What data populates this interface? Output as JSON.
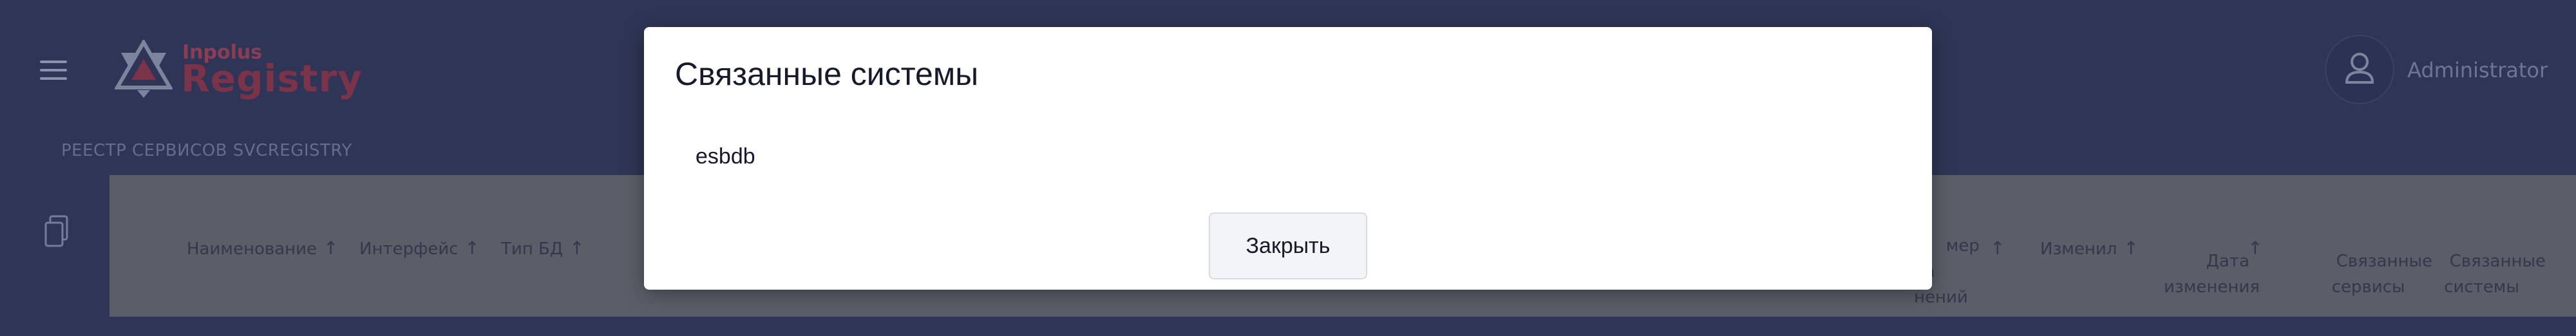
{
  "header": {
    "logo_small": "Inpolus",
    "logo_big": "Registry",
    "user_name": "Administrator",
    "menu_icon": "menu-icon",
    "user_icon": "user-icon"
  },
  "breadcrumb": "РЕЕСТР СЕРВИСОВ SVCREGISTRY",
  "sidebar": {
    "icon": "document-copy-icon"
  },
  "table": {
    "headers": [
      {
        "label": "Наименование",
        "sortable": true
      },
      {
        "label": "Интерфейс",
        "sortable": true
      },
      {
        "label": "Тип БД",
        "sortable": true
      },
      {
        "label": "мер\nла\nнений",
        "sortable": true
      },
      {
        "label": "Изменил",
        "sortable": true
      },
      {
        "label": "Дата\nизменения",
        "sortable": true
      },
      {
        "label": "Связанные\nсервисы",
        "sortable": false
      },
      {
        "label": "Связанные\nсистемы",
        "sortable": false
      }
    ]
  },
  "modal": {
    "title": "Связанные системы",
    "items": [
      "esbdb"
    ],
    "close_label": "Закрыть"
  },
  "colors": {
    "header_bg": "#2f3556",
    "accent": "#7b3349",
    "overlay_table_bg": "#5b5e68",
    "modal_bg": "#ffffff"
  }
}
